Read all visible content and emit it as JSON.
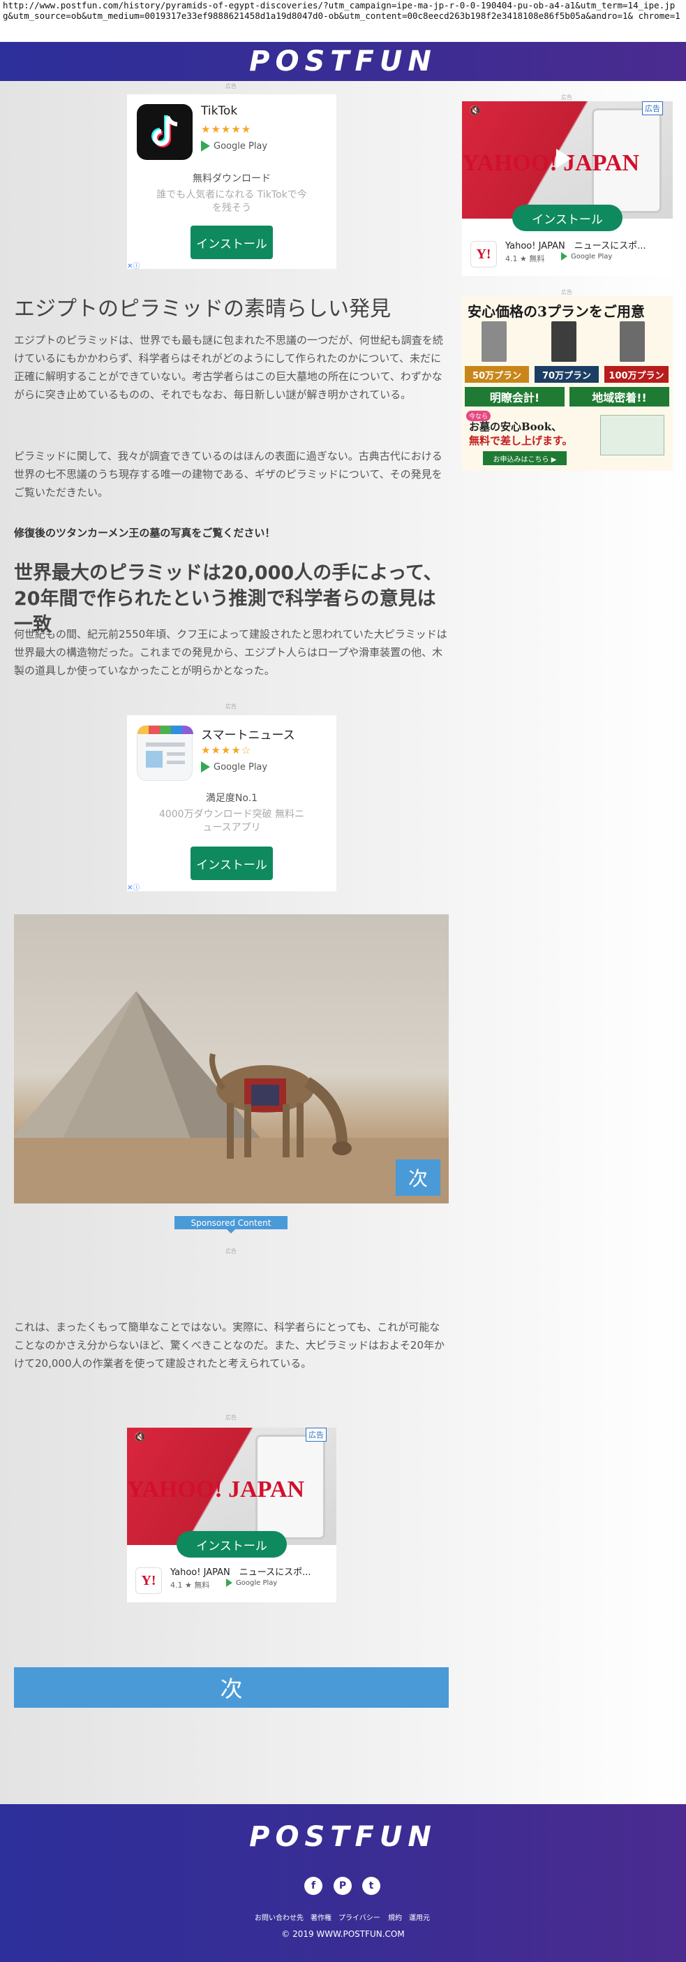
{
  "url": "http://www.postfun.com/history/pyramids-of-egypt-discoveries/?utm_campaign=ipe-ma-jp-r-0-0-190404-pu-ob-a4-a1&utm_term=14_ipe.jp g&utm_source=ob&utm_medium=0019317e33ef9888621458d1a19d8047d0-ob&utm_content=00c8eecd263b198f2e3418108e86f5b05a&andro=1& chrome=1",
  "brand": "POSTFUN",
  "ad_label": "広告",
  "ads": {
    "tiktok": {
      "name": "TikTok",
      "stars": "★★★★★",
      "store": "Google Play",
      "subtitle": "無料ダウンロード",
      "desc": "誰でも人気者になれる TikTokで今を残そう",
      "cta": "インストール"
    },
    "yahoo_side": {
      "badge": "広告",
      "logo": "YAHOO! JAPAN",
      "cta": "インストール",
      "app_name": "Yahoo! JAPAN　ニュースにスポ...",
      "rating": "4.1 ★ 無料",
      "store": "Google Play"
    },
    "ohaka": {
      "headline": "安心価格の3プランをご用意",
      "plans": [
        "50万プラン",
        "70万プラン",
        "100万プラン"
      ],
      "tags": [
        "明瞭会計!",
        "地域密着!!"
      ],
      "badge": "今なら",
      "copy1": "お墓の安心Book、",
      "copy2": "無料で差し上げます。",
      "cta": "お申込みはこちら ▶"
    },
    "smartnews": {
      "name": "スマートニュース",
      "stars": "★★★★☆",
      "store": "Google Play",
      "subtitle": "満足度No.1",
      "desc": "4000万ダウンロード突破 無料ニュースアプリ",
      "cta": "インストール"
    },
    "yahoo_main": {
      "badge": "広告",
      "logo": "YAHOO! JAPAN",
      "cta": "インストール",
      "app_name": "Yahoo! JAPAN　ニュースにスポ...",
      "rating": "4.1 ★ 無料",
      "store": "Google Play"
    }
  },
  "article": {
    "title": "エジプトのピラミッドの素晴らしい発見",
    "p1": "エジプトのピラミッドは、世界でも最も謎に包まれた不思議の一つだが、何世紀も調査を続けているにもかかわらず、科学者らはそれがどのようにして作られたのかについて、未だに正確に解明することができていない。考古学者らはこの巨大墓地の所在について、わずかながらに突き止めているものの、それでもなお、毎日新しい謎が解き明かされている。",
    "p2": "ピラミッドに関して、我々が調査できているのはほんの表面に過ぎない。古典古代における世界の七不思議のうち現存する唯一の建物である、ギザのピラミッドについて、その発見をご覧いただきたい。",
    "bold": "修復後のツタンカーメン王の墓の写真をご覧ください！",
    "h2": "世界最大のピラミッドは20,000人の手によって、20年間で作られたという推測で科学者らの意見は一致",
    "p3": "何世紀もの間、紀元前2550年頃、クフ王によって建設されたと思われていた大ピラミッドは世界最大の構造物だった。これまでの発見から、エジプト人らはロープや滑車装置の他、木製の道具しか使っていなかったことが明らかとなった。",
    "p4": "これは、まったくもって簡単なことではない。実際に、科学者らにとっても、これが可能なことなのかさえ分からないほど、驚くべきことなのだ。また、大ピラミッドはおよそ20年かけて20,000人の作業者を使って建設されたと考えられている。",
    "next_small": "次",
    "sponsored": "Sponsored Content",
    "next_big": "次"
  },
  "footer": {
    "brand": "POSTFUN",
    "social": [
      "f",
      "P",
      "t"
    ],
    "links": [
      "お問い合わせ先",
      "著作権",
      "プライバシー",
      "規約",
      "運用元"
    ],
    "copyright": "© 2019 WWW.POSTFUN.COM"
  }
}
